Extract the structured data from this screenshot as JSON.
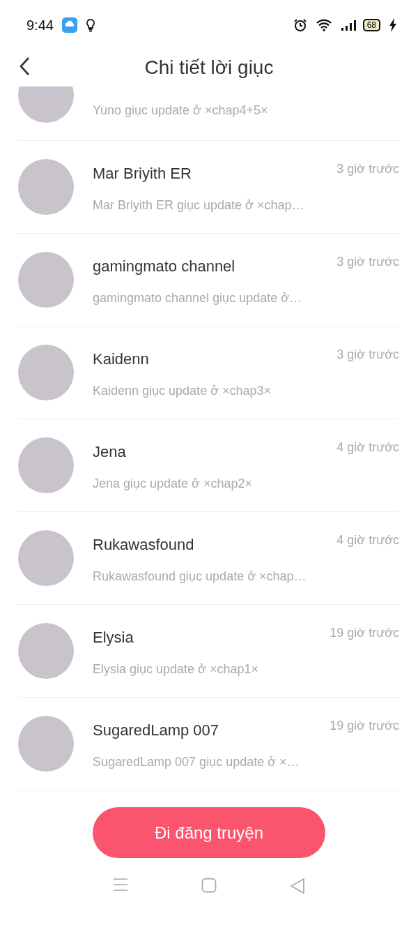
{
  "status_bar": {
    "time": "9:44",
    "battery": "68"
  },
  "header": {
    "title": "Chi tiết lời giục"
  },
  "items": [
    {
      "kind": "partial",
      "message": "Yuno giục update ở ×chap4+5×"
    },
    {
      "kind": "full",
      "name": "Mar Briyith ER",
      "time": "3 giờ trước",
      "message": "Mar Briyith ER giục update ở ×chap…"
    },
    {
      "kind": "full",
      "name": "gamingmato channel",
      "time": "3 giờ trước",
      "message": "gamingmato channel giục update ở…"
    },
    {
      "kind": "full",
      "name": "Kaidenn",
      "time": "3 giờ trước",
      "message": "Kaidenn giục update ở ×chap3×"
    },
    {
      "kind": "full",
      "name": "Jena",
      "time": "4 giờ trước",
      "message": "Jena giục update ở ×chap2×"
    },
    {
      "kind": "full",
      "name": "Rukawasfound",
      "time": "4 giờ trước",
      "message": "Rukawasfound giục update ở ×chap…"
    },
    {
      "kind": "full",
      "name": "Elysia",
      "time": "19 giờ trước",
      "message": "Elysia giục update ở ×chap1×"
    },
    {
      "kind": "full",
      "name": "SugaredLamp 007",
      "time": "19 giờ trước",
      "message": "SugaredLamp 007 giục update ở ×…"
    }
  ],
  "action_button": {
    "label": "Đi đăng truyện"
  }
}
